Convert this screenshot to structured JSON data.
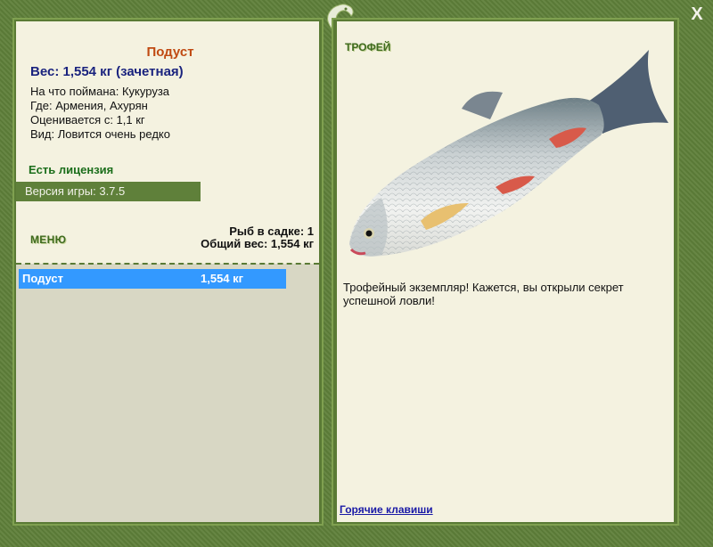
{
  "window": {
    "close_label": "X"
  },
  "fish": {
    "name": "Подуст",
    "weight_line": "Вес: 1,554 кг (зачетная)",
    "bait_line": "На что поймана: Кукуруза",
    "location_line": "Где: Армения, Ахурян",
    "valued_line": "Оценивается с: 1,1 кг",
    "kind_line": "Вид: Ловится очень редко"
  },
  "license_label": "Есть лицензия",
  "version_label": "Версия игры: 3.7.5",
  "menu_label": "МЕНЮ",
  "keepnet": {
    "count_line": "Рыб в садке: 1",
    "total_line": "Общий вес: 1,554 кг"
  },
  "catch_list": [
    {
      "name": "Подуст",
      "weight": "1,554 кг"
    }
  ],
  "trophy": {
    "label": "ТРОФЕЙ",
    "text": "Трофейный экземпляр! Кажется, вы открыли секрет успешной ловли!"
  },
  "hotkeys_label": "Горячие клавиши",
  "icons": {
    "logo": "fish-logo-icon",
    "close": "close-icon",
    "fish_image": "nase-fish-image"
  },
  "colors": {
    "frame_green": "#5f803a",
    "panel_cream": "#f4f2e0",
    "fish_name": "#c04a12",
    "weight_text": "#1a237e",
    "license_text": "#1b6e1b",
    "selection_blue": "#3399ff"
  }
}
